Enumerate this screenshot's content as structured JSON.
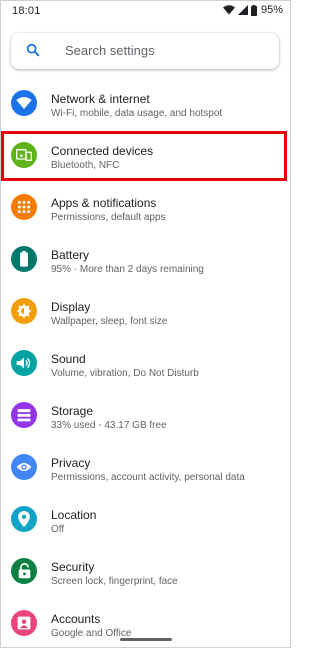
{
  "status_bar": {
    "time": "18:01",
    "battery": "95%"
  },
  "search": {
    "placeholder": "Search settings"
  },
  "items": [
    {
      "title": "Network & internet",
      "subtitle": "Wi-Fi, mobile, data usage, and hotspot",
      "color": "#1a73e8",
      "icon": "wifi-icon"
    },
    {
      "title": "Connected devices",
      "subtitle": "Bluetooth, NFC",
      "color": "#5fb31a",
      "icon": "devices-icon"
    },
    {
      "title": "Apps & notifications",
      "subtitle": "Permissions, default apps",
      "color": "#f57c00",
      "icon": "apps-icon"
    },
    {
      "title": "Battery",
      "subtitle": "95% · More than 2 days remaining",
      "color": "#00796b",
      "icon": "battery-icon"
    },
    {
      "title": "Display",
      "subtitle": "Wallpaper, sleep, font size",
      "color": "#f29d0c",
      "icon": "brightness-icon"
    },
    {
      "title": "Sound",
      "subtitle": "Volume, vibration, Do Not Disturb",
      "color": "#00a2a2",
      "icon": "volume-icon"
    },
    {
      "title": "Storage",
      "subtitle": "33% used - 43.17 GB free",
      "color": "#9334e6",
      "icon": "storage-icon"
    },
    {
      "title": "Privacy",
      "subtitle": "Permissions, account activity, personal data",
      "color": "#4285f4",
      "icon": "eye-icon"
    },
    {
      "title": "Location",
      "subtitle": "Off",
      "color": "#12a4c7",
      "icon": "location-pin-icon"
    },
    {
      "title": "Security",
      "subtitle": "Screen lock, fingerprint, face",
      "color": "#0b8043",
      "icon": "lock-icon"
    },
    {
      "title": "Accounts",
      "subtitle": "Google and Office",
      "color": "#e8457a",
      "icon": "account-icon"
    }
  ],
  "highlighted_item": "Connected devices",
  "highlight_color": "#e8000b"
}
